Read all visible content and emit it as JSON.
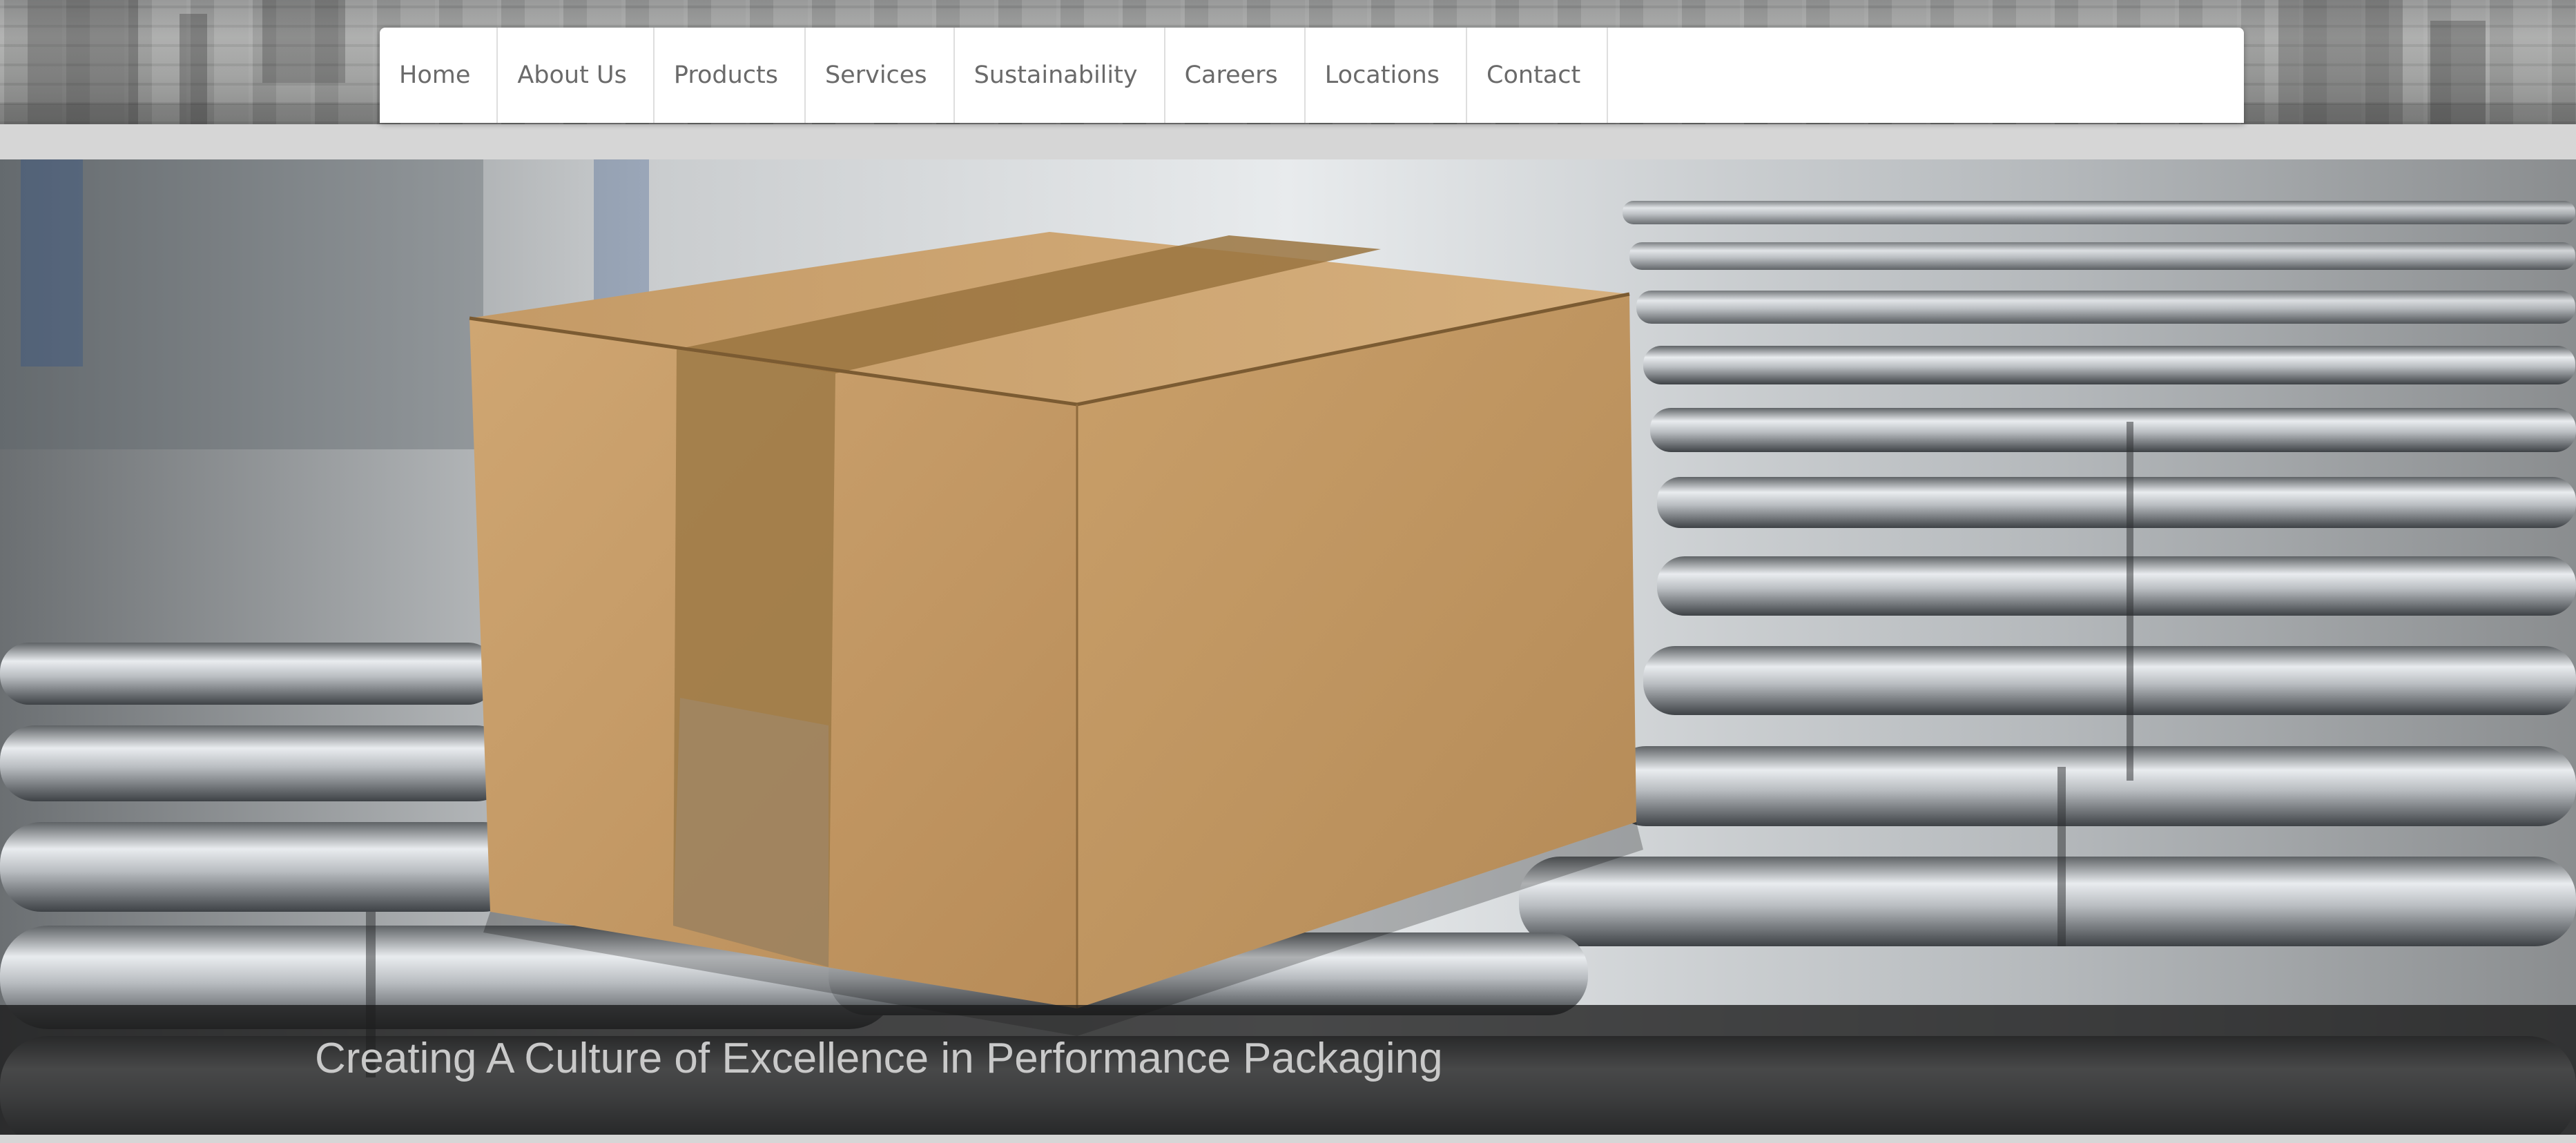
{
  "nav": {
    "items": [
      {
        "label": "Home"
      },
      {
        "label": "About Us"
      },
      {
        "label": "Products"
      },
      {
        "label": "Services"
      },
      {
        "label": "Sustainability"
      },
      {
        "label": "Careers"
      },
      {
        "label": "Locations"
      },
      {
        "label": "Contact"
      }
    ]
  },
  "hero": {
    "caption": "Creating A Culture of Excellence in Performance Packaging",
    "image_subject": "cardboard box on roller conveyor"
  },
  "colors": {
    "page_background": "#d6d6d6",
    "nav_background": "#ffffff",
    "nav_text": "#6a6a6a",
    "caption_bar": "#191919",
    "caption_text": "#c9c9c9",
    "box": "#c79b64"
  }
}
